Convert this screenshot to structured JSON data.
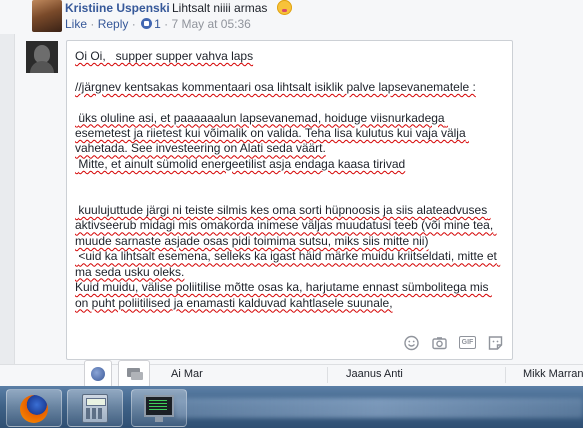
{
  "top_comment": {
    "author": "Kristiine Uspenski",
    "text": "Lihtsalt niiii armas",
    "emoji_icon": "kissing-face-emoji",
    "actions": {
      "like": "Like",
      "separator": "·",
      "reply": "Reply",
      "like_count": "1",
      "timestamp": "7 May at 05:36"
    }
  },
  "reply_composer": {
    "text": "Oi Oi,   supper supper vahva laps\n\n//järgnev kentsakas kommentaari osa lihtsalt isiklik palve lapsevanematele :\n\n üks oluline asi, et paaaaaalun lapsevanemad, hoiduge viisnurkadega esemetest ja riietest kui võimalik on valida. Teha lisa kulutus kui vaja välja vahetada. See investeering on Alati seda väärt.\n Mitte, et ainult sümolid energeetilist asja endaga kaasa tirivad\n\n\n kuulujuttude järgi ni teiste silmis kes oma sorti hüpnoosis ja siis alateadvuses aktivseerub midagi mis omakorda inimese väljas muudatusi teeb (või mine tea, muude sarnaste asjade osas pidi toimima sutsu, miks siis mitte nii)\n <uid ka lihtsalt esemena, selleks ka igast häid märke muidu kriitseldati, mitte et ma seda usku oleks.\nKuid muidu, välise poliitilise mõtte osas ka, harjutame ennast sümbolitega mis on puht poliitilised ja enamasti kalduvad kahtlasele suunale,",
    "icons": [
      "emoji-icon",
      "camera-icon",
      "gif-icon",
      "sticker-icon"
    ],
    "gif_label": "GIF"
  },
  "chat_bar": {
    "contacts": [
      "Ai Mar",
      "Jaanus Anti",
      "Mikk Marran"
    ]
  },
  "taskbar": {
    "apps": [
      "firefox-icon",
      "calculator-icon",
      "task-manager-icon"
    ]
  }
}
